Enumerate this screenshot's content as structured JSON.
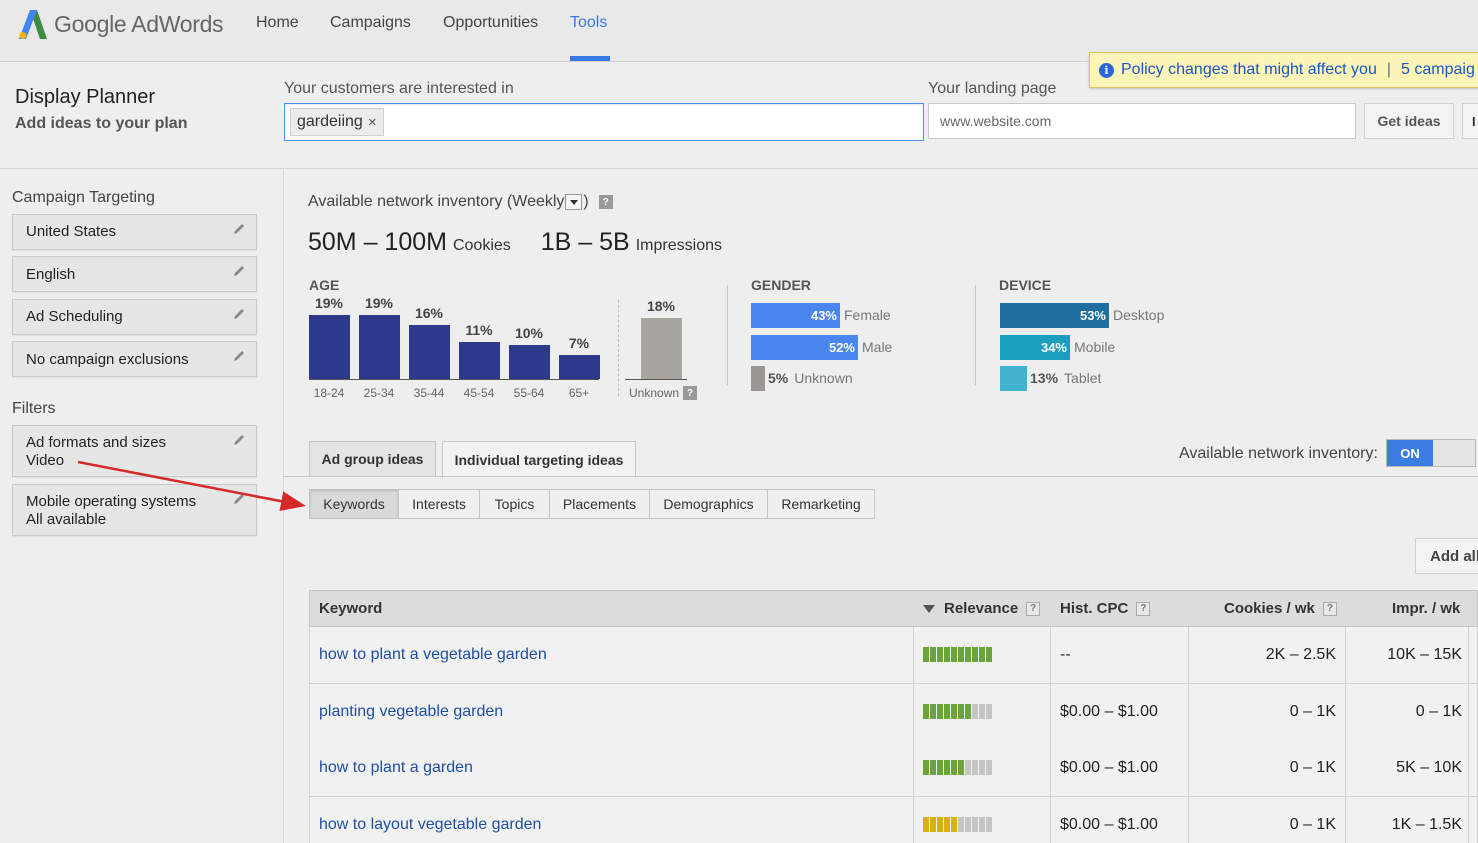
{
  "app": {
    "logo_text": "Google AdWords"
  },
  "nav": {
    "items": [
      "Home",
      "Campaigns",
      "Opportunities",
      "Tools"
    ],
    "active": "Tools"
  },
  "policy_banner": {
    "text": "Policy changes that might affect you",
    "separator": "|",
    "extra": "5 campaig"
  },
  "planner": {
    "title": "Display Planner",
    "subtitle": "Add ideas to your plan"
  },
  "customers": {
    "label": "Your customers are interested in",
    "chip": "gardeiing",
    "chip_remove": "×"
  },
  "landing": {
    "label": "Your landing page",
    "placeholder": "www.website.com"
  },
  "buttons": {
    "get_ideas": "Get ideas",
    "edge": "I",
    "add_all": "Add all"
  },
  "sidebar": {
    "campaign_targeting_title": "Campaign Targeting",
    "targeting": [
      "United States",
      "English",
      "Ad Scheduling",
      "No campaign exclusions"
    ],
    "filters_title": "Filters",
    "filters": [
      {
        "line1": "Ad formats and sizes",
        "line2": "Video"
      },
      {
        "line1": "Mobile operating systems",
        "line2": "All available"
      }
    ]
  },
  "inventory": {
    "title_pre": "Available network inventory (Weekly",
    "title_post": ")",
    "help": "?",
    "cookies_value": "50M – 100M",
    "cookies_label": "Cookies",
    "impressions_value": "1B – 5B",
    "impressions_label": "Impressions"
  },
  "age": {
    "title": "AGE",
    "categories": [
      "18-24",
      "25-34",
      "35-44",
      "45-54",
      "55-64",
      "65+"
    ],
    "pct_labels": [
      "19%",
      "19%",
      "16%",
      "11%",
      "10%",
      "7%"
    ],
    "values": [
      19,
      19,
      16,
      11,
      10,
      7
    ],
    "unknown_label": "Unknown",
    "unknown_pct": "18%",
    "unknown_value": 18,
    "bar_color": "#2d3a8c",
    "unknown_color": "#a8a4a0"
  },
  "gender": {
    "title": "GENDER",
    "items": [
      {
        "pct": "43%",
        "label": "Female",
        "value": 43,
        "color": "#4a86f0"
      },
      {
        "pct": "52%",
        "label": "Male",
        "value": 52,
        "color": "#4a86f0"
      },
      {
        "pct": "5%",
        "label": "Unknown",
        "value": 5,
        "color": "#9a9592"
      }
    ]
  },
  "device": {
    "title": "DEVICE",
    "items": [
      {
        "pct": "53%",
        "label": "Desktop",
        "value": 53,
        "color": "#1e6ea0"
      },
      {
        "pct": "34%",
        "label": "Mobile",
        "value": 34,
        "color": "#1a9fc0"
      },
      {
        "pct": "13%",
        "label": "Tablet",
        "value": 13,
        "color": "#43b4cf"
      }
    ]
  },
  "tabs": {
    "ad_group": "Ad group ideas",
    "individual": "Individual targeting ideas",
    "active": "individual"
  },
  "availability": {
    "label": "Available network inventory:",
    "toggle": "ON"
  },
  "subtabs": {
    "items": [
      "Keywords",
      "Interests",
      "Topics",
      "Placements",
      "Demographics",
      "Remarketing"
    ],
    "active": "Keywords"
  },
  "table": {
    "headers": {
      "keyword": "Keyword",
      "relevance": "Relevance",
      "cpc": "Hist. CPC",
      "cookies": "Cookies / wk",
      "impr": "Impr. / wk"
    },
    "rows": [
      {
        "keyword": "how to plant a vegetable garden",
        "relevance": 10,
        "relevance_color": "#6aa43a",
        "cpc": "--",
        "cookies": "2K – 2.5K",
        "impr": "10K – 15K"
      },
      {
        "keyword": "planting vegetable garden",
        "relevance": 7,
        "relevance_color": "#6aa43a",
        "cpc": "$0.00 – $1.00",
        "cookies": "0 – 1K",
        "impr": "0 – 1K"
      },
      {
        "keyword": "how to plant a garden",
        "relevance": 6,
        "relevance_color": "#6aa43a",
        "cpc": "$0.00 – $1.00",
        "cookies": "0 – 1K",
        "impr": "5K – 10K"
      },
      {
        "keyword": "how to layout vegetable garden",
        "relevance": 5,
        "relevance_color": "#d8b014",
        "cpc": "$0.00 – $1.00",
        "cookies": "0 – 1K",
        "impr": "1K – 1.5K"
      }
    ]
  },
  "colors": {
    "accent": "#3b78e7",
    "link": "#1e4fa3",
    "annotation_arrow": "#d42a2a"
  }
}
